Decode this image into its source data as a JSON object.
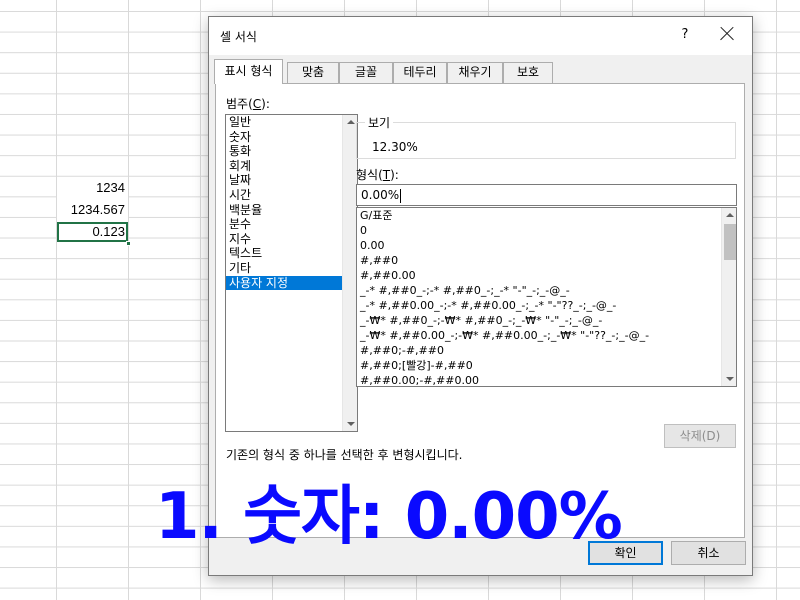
{
  "sheet": {
    "cells": [
      "1234",
      "1234.567",
      "0.123"
    ]
  },
  "dialog": {
    "title": "셀 서식",
    "help_label": "?",
    "tabs": [
      "표시 형식",
      "맞춤",
      "글꼴",
      "테두리",
      "채우기",
      "보호"
    ],
    "active_tab": "표시 형식",
    "category_label": "범주(C):",
    "categories": [
      "일반",
      "숫자",
      "통화",
      "회계",
      "날짜",
      "시간",
      "백분율",
      "분수",
      "지수",
      "텍스트",
      "기타",
      "사용자 지정"
    ],
    "selected_category": "사용자 지정",
    "preview_label": "보기",
    "preview_value": "12.30%",
    "type_label": "형식(T):",
    "type_value": "0.00%",
    "formats": [
      "G/표준",
      "0",
      "0.00",
      "#,##0",
      "#,##0.00",
      "_-* #,##0_-;-* #,##0_-;_-* \"-\"_-;_-@_-",
      "_-* #,##0.00_-;-* #,##0.00_-;_-* \"-\"??_-;_-@_-",
      "_-₩* #,##0_-;-₩* #,##0_-;_-₩* \"-\"_-;_-@_-",
      "_-₩* #,##0.00_-;-₩* #,##0.00_-;_-₩* \"-\"??_-;_-@_-",
      "#,##0;-#,##0",
      "#,##0;[빨강]-#,##0",
      "#,##0.00;-#,##0.00"
    ],
    "delete_label": "삭제(D)",
    "description": "기존의 형식 중 하나를 선택한 후 변형시킵니다.",
    "ok_label": "확인",
    "cancel_label": "취소"
  },
  "overlay": {
    "caption": "1. 숫자: 0.00%",
    "color": "#0a0aff"
  },
  "colors": {
    "selection": "#0078d7",
    "active_cell_border": "#217346"
  }
}
